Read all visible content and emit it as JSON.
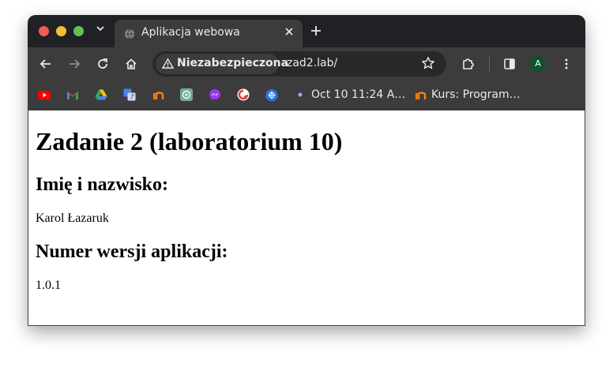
{
  "browser": {
    "tab": {
      "title": "Aplikacja webowa"
    },
    "omnibox": {
      "security_label": "Niezabezpieczona",
      "url": "zad2.lab/"
    },
    "profile": {
      "initial": "A"
    },
    "bookmarks": [
      {
        "icon": "youtube-icon",
        "label": ""
      },
      {
        "icon": "gmail-icon",
        "label": ""
      },
      {
        "icon": "google-drive-icon",
        "label": ""
      },
      {
        "icon": "google-translate-icon",
        "label": ""
      },
      {
        "icon": "course-platform-icon",
        "label": ""
      },
      {
        "icon": "chatgpt-icon",
        "label": ""
      },
      {
        "icon": "messenger-icon",
        "label": ""
      },
      {
        "icon": "red-circle-app-icon",
        "label": ""
      },
      {
        "icon": "kubernetes-icon",
        "label": ""
      },
      {
        "icon": "dot-icon",
        "label": "Oct 10 11:24 A…"
      },
      {
        "icon": "course-platform-icon",
        "label": "Kurs: Program…"
      }
    ]
  },
  "page": {
    "heading": "Zadanie 2 (laboratorium 10)",
    "name_heading": "Imię i nazwisko:",
    "name_value": "Karol Łazaruk",
    "version_heading": "Numer wersji aplikacji:",
    "version_value": "1.0.1"
  },
  "colors": {
    "titlebar": "#202124",
    "toolbar": "#3c3c3c",
    "omnibox": "#282828",
    "avatar": "#0f5132"
  }
}
